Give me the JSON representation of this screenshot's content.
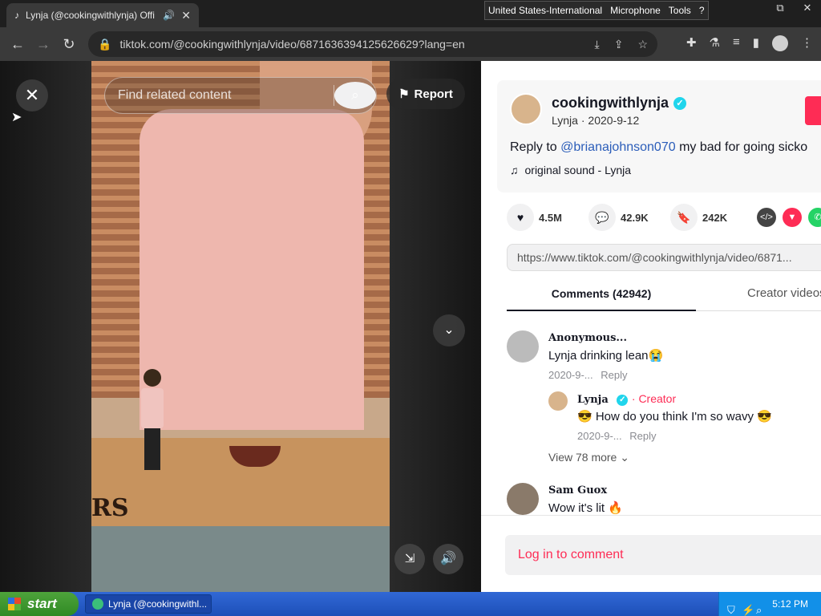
{
  "browser": {
    "tab_title": "Lynja (@cookingwithlynja) Offi",
    "url": "tiktok.com/@cookingwithlynja/video/6871636394125626629?lang=en",
    "language_bar": {
      "language": "United States-International",
      "microphone": "Microphone",
      "tools": "Tools"
    }
  },
  "video": {
    "search_placeholder": "Find related content",
    "report_label": "Report",
    "sticker_text": "RS"
  },
  "author": {
    "username": "cookingwithlynja",
    "nickname": "Lynja",
    "date": "2020-9-12",
    "desc_prefix": "Reply to",
    "desc_mention": "@brianajohnson070",
    "desc_rest": "my bad for going sicko",
    "sound": "original sound - Lynja"
  },
  "stats": {
    "likes": "4.5M",
    "comments": "42.9K",
    "saves": "242K"
  },
  "share_link": "https://www.tiktok.com/@cookingwithlynja/video/6871...",
  "tabs": {
    "comments": "Comments (42942)",
    "creator_videos": "Creator videos"
  },
  "comments": [
    {
      "name": "Anonymous...",
      "text": "Lynja drinking lean😭",
      "date": "2020-9-...",
      "reply": "Reply"
    },
    {
      "name": "Lynja",
      "creator_label": "Creator",
      "text": "😎 How do you think I'm so wavy 😎",
      "date": "2020-9-...",
      "reply": "Reply"
    },
    {
      "name": "Sam Guox",
      "text": "Wow it's lit 🔥"
    }
  ],
  "view_more": "View 78 more",
  "login_comment": "Log in to comment",
  "taskbar": {
    "start": "start",
    "task_label": "Lynja (@cookingwithl...",
    "clock": "5:12 PM"
  }
}
